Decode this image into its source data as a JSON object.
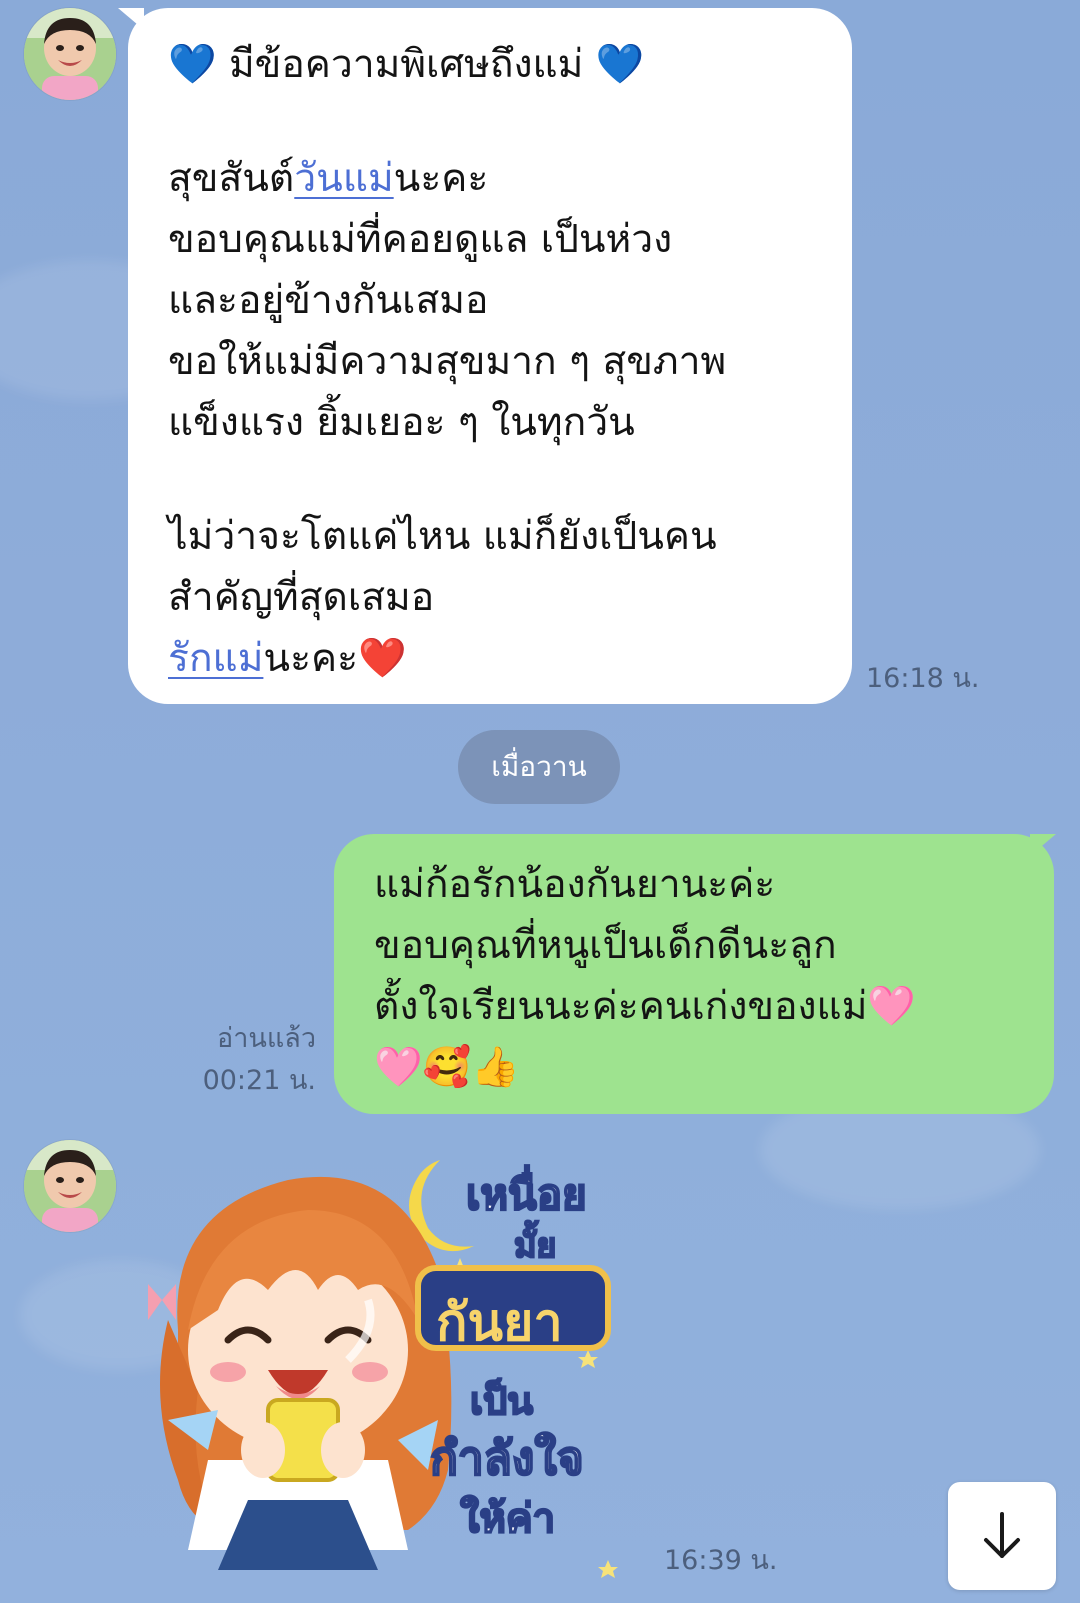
{
  "messages": {
    "incoming_1": {
      "lines": [
        "💙 มีข้อความพิเศษถึงแม่ 💙",
        "",
        "สุขสันต์|วันแม่|นะคะ",
        "ขอบคุณแม่ที่คอยดูแล เป็นห่วง",
        "และอยู่ข้างกันเสมอ",
        "ขอให้แม่มีความสุขมาก ๆ สุขภาพ",
        "แข็งแรง ยิ้มเยอะ ๆ ในทุกวัน",
        "",
        "ไม่ว่าจะโตแค่ไหน แม่ก็ยังเป็นคน",
        "สำคัญที่สุดเสมอ",
        "|รักแม่|นะคะ❤️"
      ],
      "line1": "💙 มีข้อความพิเศษถึงแม่ 💙",
      "line3_pre": "สุขสันต์",
      "line3_link": "วันแม่",
      "line3_post": "นะคะ",
      "line4": "ขอบคุณแม่ที่คอยดูแล เป็นห่วง",
      "line5": "และอยู่ข้างกันเสมอ",
      "line6": "ขอให้แม่มีความสุขมาก ๆ สุขภาพ",
      "line7": "แข็งแรง ยิ้มเยอะ ๆ ในทุกวัน",
      "line9": "ไม่ว่าจะโตแค่ไหน แม่ก็ยังเป็นคน",
      "line10": "สำคัญที่สุดเสมอ",
      "line11_link": "รักแม่",
      "line11_post": "นะคะ❤️",
      "time": "16:18 น."
    },
    "date_separator": "เมื่อวาน",
    "outgoing_1": {
      "line1": "แม่ก้อรักน้องกันยานะค่ะ",
      "line2": "ขอบคุณที่หนูเป็นเด็กดีนะลูก",
      "line3": "ตั้งใจเรียนนะค่ะคนเก่งของแม่🩷",
      "line4": "🩷🥰👍",
      "read_status": "อ่านแล้ว",
      "time": "00:21 น."
    },
    "incoming_sticker": {
      "text_1": "เหนื่อย",
      "text_2": "มั้ย",
      "text_3": "กันยา",
      "text_4": "เป็น",
      "text_5": "กำลังใจ",
      "text_6": "ให้ค่า",
      "time": "16:39 น."
    }
  },
  "icons": {
    "scroll_down": "arrow-down-icon",
    "avatar": "contact-avatar"
  },
  "colors": {
    "background": "#8eacd9",
    "incoming_bubble": "#ffffff",
    "outgoing_bubble": "#9ee38f",
    "link": "#4d6fd4",
    "date_pill": "#7c93b8"
  }
}
